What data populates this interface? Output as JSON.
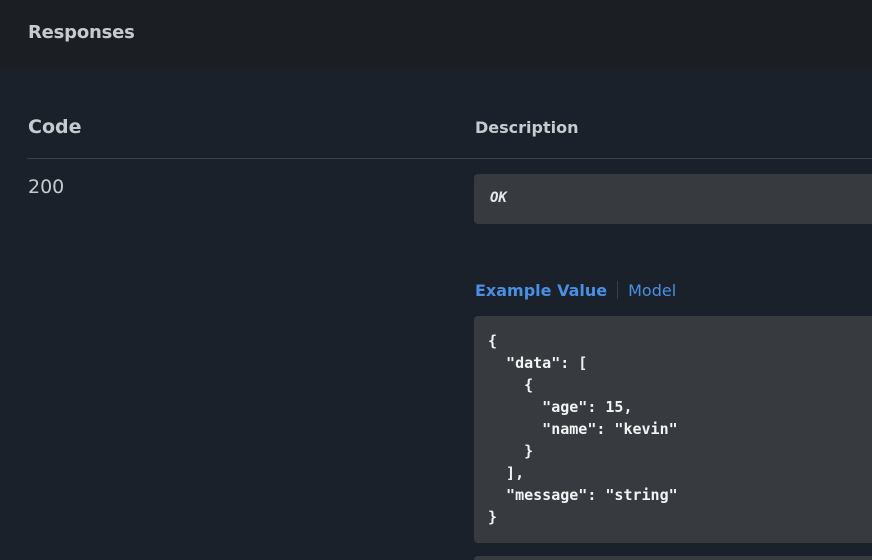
{
  "header": {
    "title": "Responses"
  },
  "table": {
    "col_code": "Code",
    "col_description": "Description"
  },
  "response": {
    "code": "200",
    "description": "OK"
  },
  "tabs": {
    "example_value": "Example Value",
    "model": "Model"
  },
  "example_json": "{\n  \"data\": [\n    {\n      \"age\": 15,\n      \"name\": \"kevin\"\n    }\n  ],\n  \"message\": \"string\"\n}",
  "colors": {
    "page_bg": "#1a212b",
    "header_bg": "#1b1e22",
    "panel_bg": "#373a3e",
    "text_muted": "#c7cbd0",
    "link_blue": "#4990e2"
  }
}
